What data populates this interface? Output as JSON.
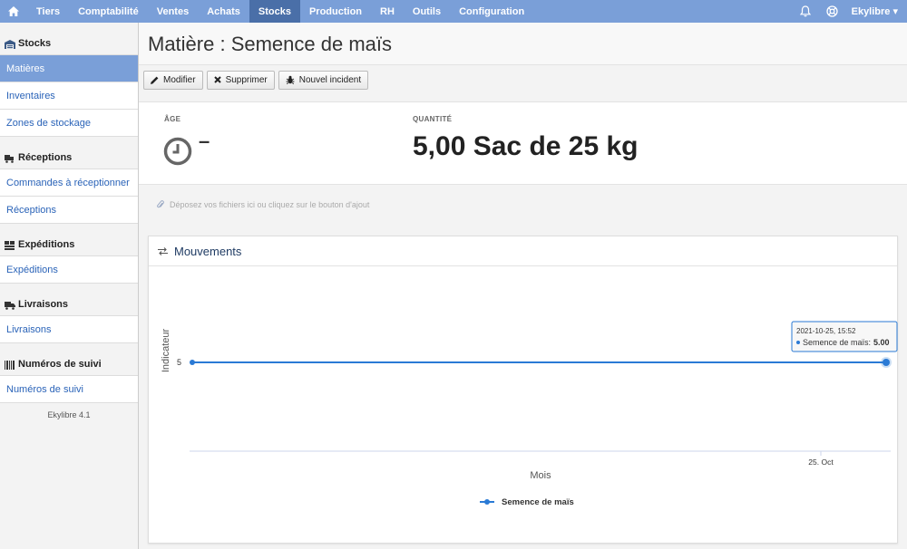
{
  "topnav": {
    "items": [
      {
        "label": "Tiers",
        "active": false
      },
      {
        "label": "Comptabilité",
        "active": false
      },
      {
        "label": "Ventes",
        "active": false
      },
      {
        "label": "Achats",
        "active": false
      },
      {
        "label": "Stocks",
        "active": true
      },
      {
        "label": "Production",
        "active": false
      },
      {
        "label": "RH",
        "active": false
      },
      {
        "label": "Outils",
        "active": false
      },
      {
        "label": "Configuration",
        "active": false
      }
    ],
    "user": "Ekylibre ▾"
  },
  "sidebar": {
    "sections": [
      {
        "title": "Stocks",
        "icon": "warehouse-icon",
        "items": [
          {
            "label": "Matières",
            "active": true
          },
          {
            "label": "Inventaires",
            "active": false
          },
          {
            "label": "Zones de stockage",
            "active": false
          }
        ]
      },
      {
        "title": "Réceptions",
        "icon": "truck-loading-icon",
        "items": [
          {
            "label": "Commandes à réceptionner",
            "active": false
          },
          {
            "label": "Réceptions",
            "active": false
          }
        ]
      },
      {
        "title": "Expéditions",
        "icon": "boxes-icon",
        "items": [
          {
            "label": "Expéditions",
            "active": false
          }
        ]
      },
      {
        "title": "Livraisons",
        "icon": "truck-icon",
        "items": [
          {
            "label": "Livraisons",
            "active": false
          }
        ]
      },
      {
        "title": "Numéros de suivi",
        "icon": "barcode-icon",
        "items": [
          {
            "label": "Numéros de suivi",
            "active": false
          }
        ]
      }
    ],
    "version": "Ekylibre 4.1"
  },
  "page": {
    "title": "Matière : Semence de maïs",
    "buttons": {
      "edit": "Modifier",
      "delete": "Supprimer",
      "incident": "Nouvel incident"
    },
    "age_label": "ÂGE",
    "age_value": "–",
    "qty_label": "QUANTITÉ",
    "qty_value": "5,00 Sac de 25 kg",
    "dropzone": "Déposez vos fichiers ici ou cliquez sur le bouton d'ajout"
  },
  "movements": {
    "title": "Mouvements",
    "tooltip_date": "2021-10-25, 15:52",
    "tooltip_series": "Semence de maïs:",
    "tooltip_value": "5.00"
  },
  "colors": {
    "nav": "#7a9fd8",
    "nav_active": "#4a6fa8",
    "link": "#2a63b8",
    "series": "#2a7ad5"
  },
  "chart_data": {
    "type": "line",
    "x": [
      "2021-10-01",
      "2021-10-25"
    ],
    "series": [
      {
        "name": "Semence de maïs",
        "values": [
          5,
          5
        ]
      }
    ],
    "xlabel": "Mois",
    "ylabel": "Indicateur",
    "x_tick_labels": [
      "25. Oct"
    ],
    "y_tick_labels": [
      "5"
    ],
    "legend": "bottom-center",
    "grid": false
  }
}
